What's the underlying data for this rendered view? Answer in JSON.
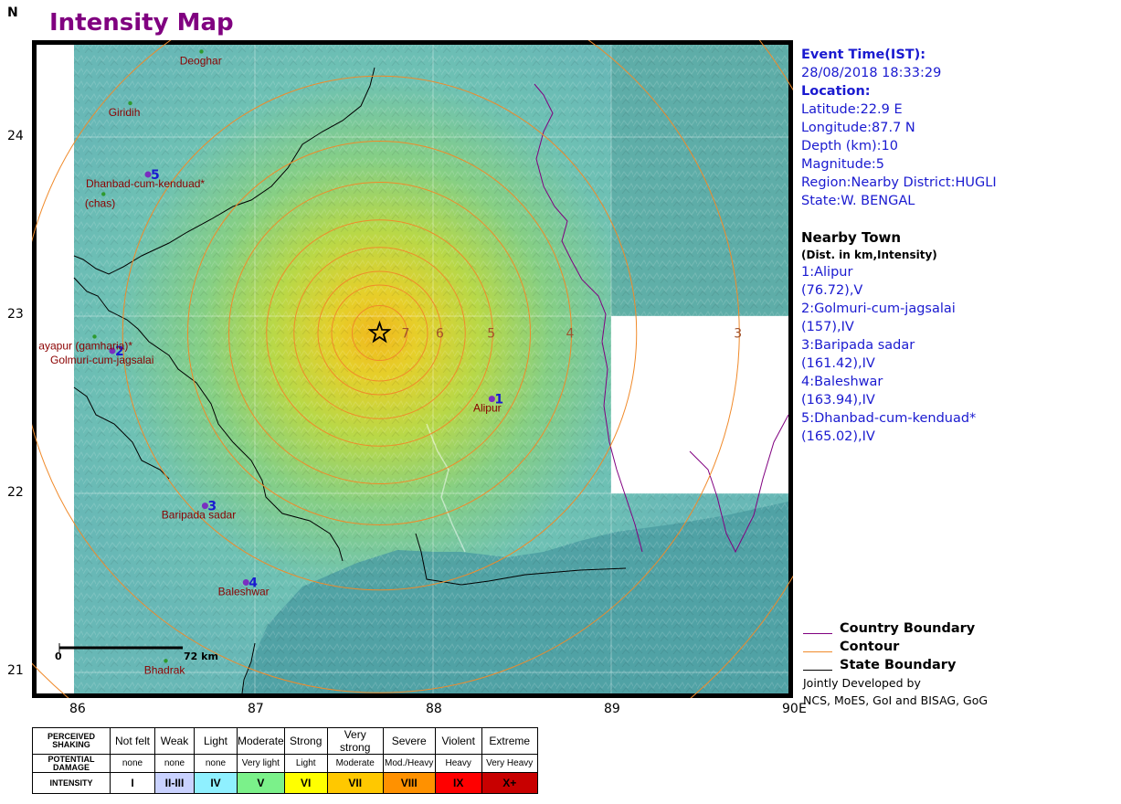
{
  "header": {
    "north_marker": "N",
    "title": "Intensity Map"
  },
  "map": {
    "y_ticks": [
      {
        "label": "24",
        "lat": 24
      },
      {
        "label": "23",
        "lat": 23
      },
      {
        "label": "22",
        "lat": 22
      },
      {
        "label": "21",
        "lat": 21
      }
    ],
    "x_ticks": [
      {
        "label": "86",
        "lon": 86
      },
      {
        "label": "87",
        "lon": 87
      },
      {
        "label": "88",
        "lon": 88
      },
      {
        "label": "89",
        "lon": 89
      },
      {
        "label": "90",
        "lon": 90
      }
    ],
    "x_suffix": "E",
    "epicenter": {
      "lat": 22.9,
      "lon": 87.7
    },
    "contours": [
      {
        "label": "7",
        "radius_km": 16
      },
      {
        "label": "6",
        "radius_km": 36
      },
      {
        "label": "5",
        "radius_km": 66
      },
      {
        "label": "4",
        "radius_km": 112
      },
      {
        "label": "3",
        "radius_km": 210
      },
      {
        "label": "",
        "radius_km": 28
      },
      {
        "label": "",
        "radius_km": 50
      },
      {
        "label": "",
        "radius_km": 88
      },
      {
        "label": "",
        "radius_km": 150
      },
      {
        "label": "",
        "radius_km": 280
      }
    ],
    "towns": [
      {
        "name": "Deoghar",
        "lat": 24.48,
        "lon": 86.7,
        "num": ""
      },
      {
        "name": "Giridih",
        "lat": 24.19,
        "lon": 86.3,
        "num": ""
      },
      {
        "name": "Dhanbad-cum-kenduad*",
        "lat": 23.79,
        "lon": 86.4,
        "num": "5"
      },
      {
        "name": "(chas)",
        "lat": 23.68,
        "lon": 86.15,
        "num": ""
      },
      {
        "name": "Golmuri-cum-jagsalai",
        "lat": 22.8,
        "lon": 86.2,
        "num": "2"
      },
      {
        "name": "ayapur (gamharia)*",
        "lat": 22.88,
        "lon": 86.1,
        "num": ""
      },
      {
        "name": "Alipur",
        "lat": 22.53,
        "lon": 88.33,
        "num": "1"
      },
      {
        "name": "Baripada sadar",
        "lat": 21.93,
        "lon": 86.72,
        "num": "3"
      },
      {
        "name": "Baleshwar",
        "lat": 21.5,
        "lon": 86.95,
        "num": "4"
      },
      {
        "name": "Bhadrak",
        "lat": 21.06,
        "lon": 86.5,
        "num": ""
      }
    ],
    "scale_bar": {
      "start_label": "0",
      "end_label": "72 km"
    },
    "colors": {
      "ocean": "#4a9a9e",
      "land_low": "#6fc3b4",
      "land_mid": "#8fd18a",
      "land_high": "#d7d83c",
      "center": "#f0c020",
      "contour": "#f08a2a",
      "state_boundary": "#000000",
      "country_boundary": "#800080"
    }
  },
  "event": {
    "time_label": "Event Time(IST):",
    "time_value": "28/08/2018 18:33:29",
    "location_label": "Location:",
    "latitude": "Latitude:22.9 E",
    "longitude": "Longitude:87.7 N",
    "depth": "Depth (km):10",
    "magnitude": "Magnitude:5",
    "region": "Region:Nearby District:HUGLI",
    "state": "State:W. BENGAL"
  },
  "nearby": {
    "title": "Nearby Town",
    "subtitle": "(Dist. in km,Intensity)",
    "items": [
      {
        "name": "1:Alipur",
        "detail": "(76.72),V"
      },
      {
        "name": "2:Golmuri-cum-jagsalai",
        "detail": "(157),IV"
      },
      {
        "name": "3:Baripada sadar",
        "detail": "(161.42),IV"
      },
      {
        "name": "4:Baleshwar",
        "detail": "(163.94),IV"
      },
      {
        "name": "5:Dhanbad-cum-kenduad*",
        "detail": "(165.02),IV"
      }
    ]
  },
  "legend": {
    "items": [
      {
        "label": "Country Boundary",
        "color": "#800080"
      },
      {
        "label": "Contour",
        "color": "#f08a2a"
      },
      {
        "label": "State Boundary",
        "color": "#000000"
      }
    ],
    "credit_line1": "Jointly Developed by",
    "credit_line2": "NCS, MoES, GoI and BISAG, GoG"
  },
  "scale": {
    "row_labels": {
      "perceived": "PERCEIVED SHAKING",
      "damage": "POTENTIAL DAMAGE",
      "intensity": "INTENSITY"
    },
    "columns": [
      {
        "shaking": "Not felt",
        "damage": "none",
        "intensity": "I",
        "color": "#ffffff"
      },
      {
        "shaking": "Weak",
        "damage": "none",
        "intensity": "II-III",
        "color": "#c9d2ff"
      },
      {
        "shaking": "Light",
        "damage": "none",
        "intensity": "IV",
        "color": "#8ff0ff"
      },
      {
        "shaking": "Moderate",
        "damage": "Very light",
        "intensity": "V",
        "color": "#7bf18a"
      },
      {
        "shaking": "Strong",
        "damage": "Light",
        "intensity": "VI",
        "color": "#ffff00"
      },
      {
        "shaking": "Very strong",
        "damage": "Moderate",
        "intensity": "VII",
        "color": "#ffc800"
      },
      {
        "shaking": "Severe",
        "damage": "Mod./Heavy",
        "intensity": "VIII",
        "color": "#ff9100"
      },
      {
        "shaking": "Violent",
        "damage": "Heavy",
        "intensity": "IX",
        "color": "#ff0000"
      },
      {
        "shaking": "Extreme",
        "damage": "Very Heavy",
        "intensity": "X+",
        "color": "#c80000"
      }
    ]
  }
}
